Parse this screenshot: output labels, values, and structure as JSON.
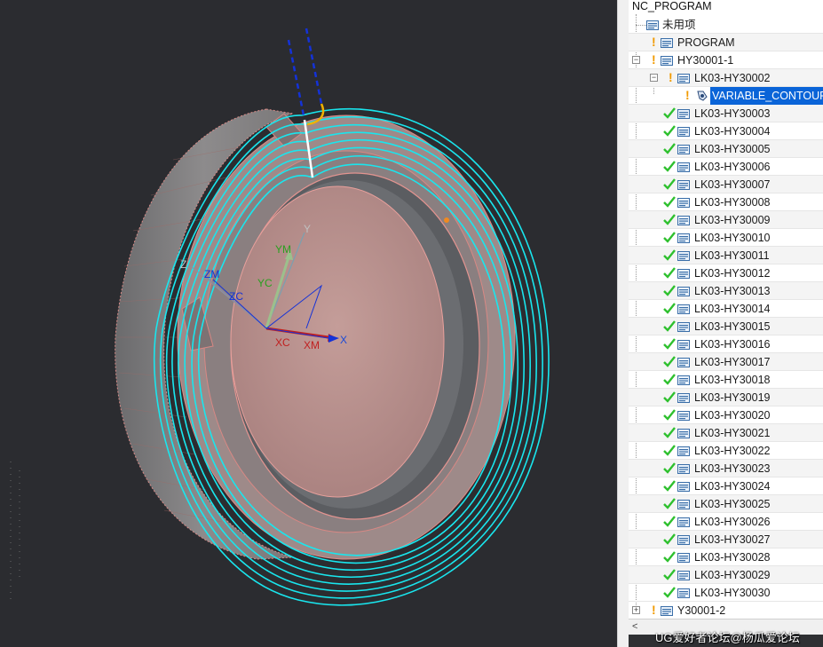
{
  "viewport": {
    "axis_labels": {
      "x": "X",
      "y": "Y",
      "z": "Z",
      "xm": "XM",
      "ym": "YM",
      "zm": "ZM",
      "xc": "XC",
      "yc": "YC",
      "zc": "ZC"
    },
    "colors": {
      "background": "#2b2c30",
      "part": "#b58f8c",
      "toolpath": "#19e6ee",
      "tool_axis": "#1432d8"
    }
  },
  "navigator": {
    "root": "NC_PROGRAM",
    "unused": "未用项",
    "program": "PROGRAM",
    "group1": "HY30001-1",
    "sub_group": "LK03-HY30002",
    "operation": "VARIABLE_CONTOUR",
    "items": [
      "LK03-HY30003",
      "LK03-HY30004",
      "LK03-HY30005",
      "LK03-HY30006",
      "LK03-HY30007",
      "LK03-HY30008",
      "LK03-HY30009",
      "LK03-HY30010",
      "LK03-HY30011",
      "LK03-HY30012",
      "LK03-HY30013",
      "LK03-HY30014",
      "LK03-HY30015",
      "LK03-HY30016",
      "LK03-HY30017",
      "LK03-HY30018",
      "LK03-HY30019",
      "LK03-HY30020",
      "LK03-HY30021",
      "LK03-HY30022",
      "LK03-HY30023",
      "LK03-HY30024",
      "LK03-HY30025",
      "LK03-HY30026",
      "LK03-HY30027",
      "LK03-HY30028",
      "LK03-HY30029",
      "LK03-HY30030"
    ],
    "group2": "Y30001-2",
    "icons": {
      "folder": "program-folder-icon",
      "check": "status-complete-icon",
      "warn": "status-regenerate-icon",
      "operation": "operation-tool-icon"
    }
  },
  "watermark": "UG爱好者论坛@杨瓜爱论坛"
}
